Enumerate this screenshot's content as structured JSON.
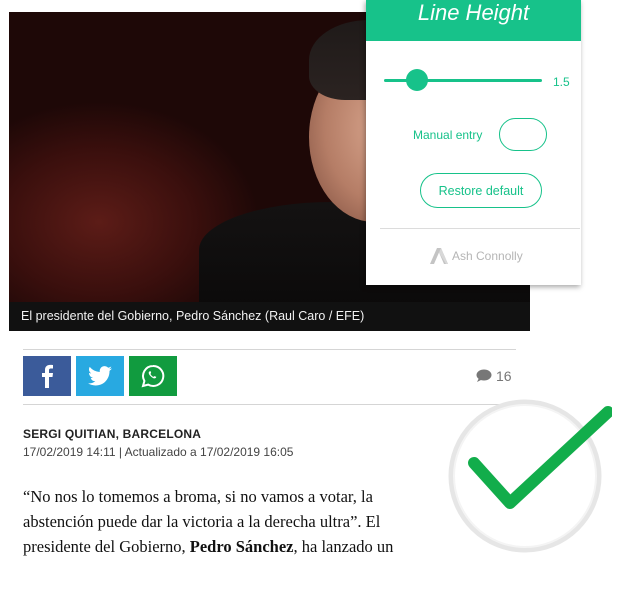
{
  "photo": {
    "caption": "El presidente del Gobierno, Pedro Sánchez (Raul Caro / EFE)"
  },
  "share": [
    {
      "name": "facebook",
      "icon": "f"
    },
    {
      "name": "twitter",
      "icon": "twitter-bird"
    },
    {
      "name": "whatsapp",
      "icon": "whatsapp"
    }
  ],
  "comments": {
    "count": "16",
    "icon": "comment-bubble-icon"
  },
  "article": {
    "author": "SERGI QUITIAN, BARCELONA",
    "dates": "17/02/2019 14:11 | Actualizado a 17/02/2019 16:05",
    "line1": "“No nos lo tomemos a broma, si no vamos a votar, la",
    "line2": "abstención puede dar la victoria a la derecha ultra”. El",
    "line3_pre": "presidente del Gobierno, ",
    "line3_bold": "Pedro Sánchez",
    "line3_post": ", ha lanzado un"
  },
  "panel": {
    "title": "Line Height",
    "slider_value": "1.5",
    "slider_level": 0.21,
    "manual_label": "Manual entry",
    "manual_value": "",
    "restore_label": "Restore default",
    "footer": "Ash Connolly",
    "accent": "#17c28a"
  },
  "checkmark": {
    "color": "#12ad4b"
  }
}
